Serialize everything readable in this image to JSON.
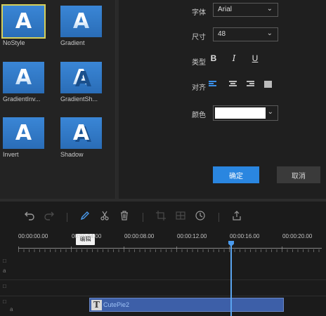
{
  "styles": [
    {
      "name": "NoStyle",
      "letter": "A",
      "selected": true
    },
    {
      "name": "Gradient",
      "letter": "A"
    },
    {
      "name": "GradientInv...",
      "letter": "A"
    },
    {
      "name": "GradientSh...",
      "letter": "A"
    },
    {
      "name": "Invert",
      "letter": "A"
    },
    {
      "name": "Shadow",
      "letter": "A"
    }
  ],
  "settings": {
    "font_label": "字体",
    "font_value": "Arial",
    "size_label": "尺寸",
    "size_value": "48",
    "type_label": "类型",
    "bold": "B",
    "italic": "I",
    "underline": "U",
    "align_label": "对齐",
    "color_label": "颜色",
    "color_value": "#ffffff",
    "chevron": "⌄"
  },
  "buttons": {
    "ok": "确定",
    "cancel": "取消"
  },
  "toolbar": {
    "tooltip": "编辑"
  },
  "timeline": {
    "times": [
      "00:00:00.00",
      "00:00:04.00",
      "00:00:08.00",
      "00:00:12.00",
      "00:00:16.00",
      "00:00:20.00"
    ],
    "clip_name": "CutePie2",
    "clip_icon": "T"
  },
  "colors": {
    "accent": "#2a86e0",
    "clip": "#3d5fa8",
    "selected_outline": "#d6d05a"
  }
}
